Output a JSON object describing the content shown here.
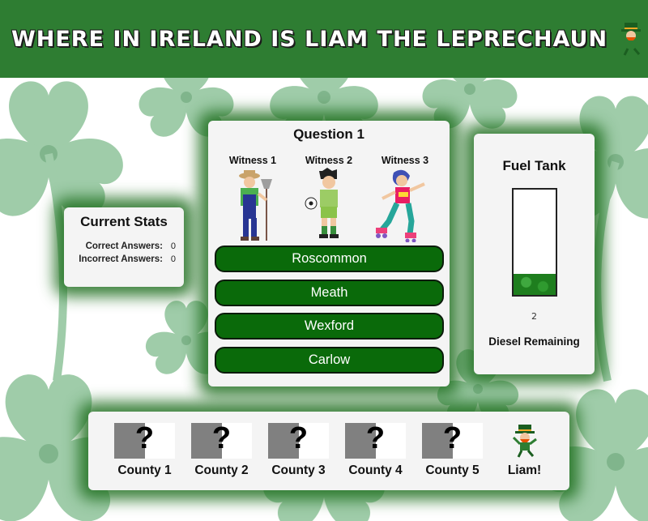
{
  "header": {
    "title": "Where in Ireland is Liam the Leprechaun",
    "logo_icon": "leprechaun-icon"
  },
  "stats": {
    "title": "Current Stats",
    "correct_label": "Correct Answers:",
    "correct_value": "0",
    "incorrect_label": "Incorrect Answers:",
    "incorrect_value": "0"
  },
  "question": {
    "title": "Question 1",
    "witnesses": [
      {
        "label": "Witness 1",
        "icon": "farmer-icon"
      },
      {
        "label": "Witness 2",
        "icon": "footballer-icon"
      },
      {
        "label": "Witness 3",
        "icon": "roller-skater-icon"
      }
    ],
    "answers": [
      "Roscommon",
      "Meath",
      "Wexford",
      "Carlow"
    ]
  },
  "fuel": {
    "title": "Fuel Tank",
    "level_fraction": 0.2,
    "value": "2",
    "footer": "Diesel Remaining"
  },
  "counties": {
    "items": [
      {
        "label": "County 1",
        "mark": "?"
      },
      {
        "label": "County 2",
        "mark": "?"
      },
      {
        "label": "County 3",
        "mark": "?"
      },
      {
        "label": "County 4",
        "mark": "?"
      },
      {
        "label": "County 5",
        "mark": "?"
      }
    ],
    "liam_label": "Liam!"
  },
  "colors": {
    "header_green": "#2e7d32",
    "button_green": "#0a6a0a",
    "glow_green": "#1e6e1e"
  }
}
